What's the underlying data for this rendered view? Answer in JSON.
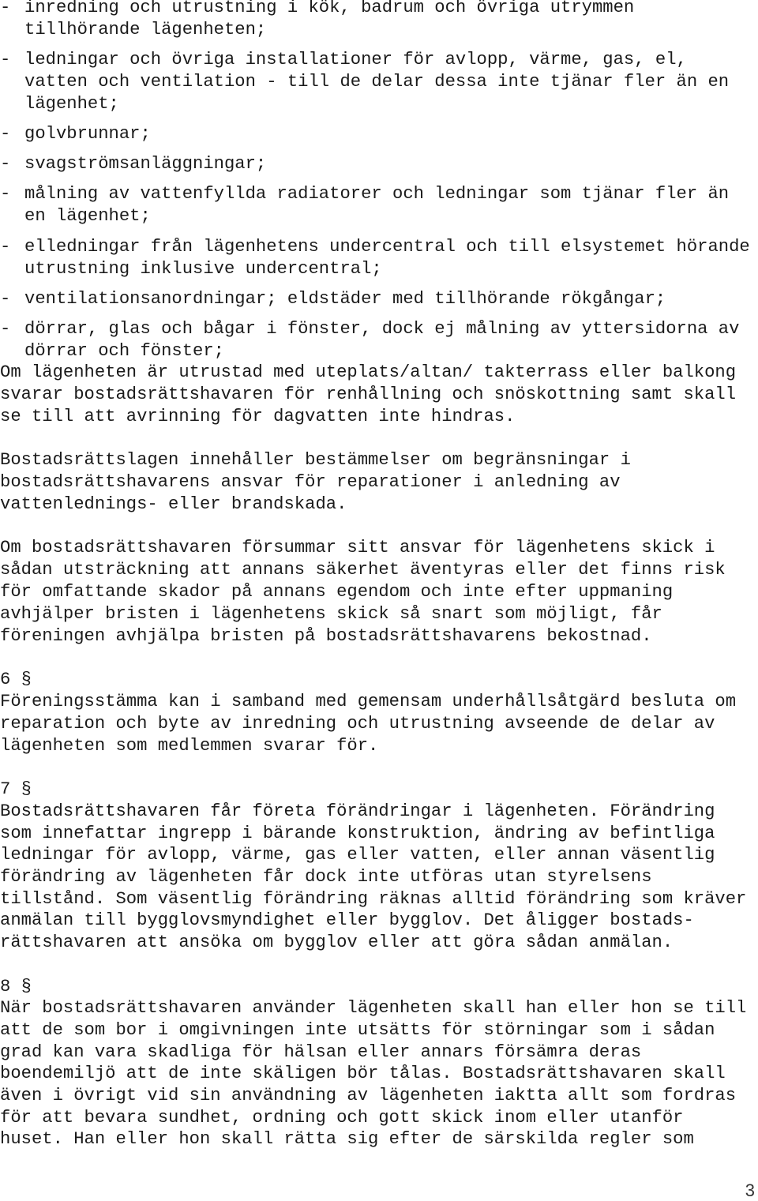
{
  "document": {
    "bullet_marker": "-",
    "bullets": [
      {
        "lines": [
          "inredning och utrustning i kök, badrum och övriga utrymmen",
          "tillhörande lägenheten;"
        ]
      },
      {
        "lines": [
          "ledningar och övriga installationer för avlopp, värme, gas, el,",
          "vatten och ventilation - till de delar dessa inte tjänar fler än en",
          "lägenhet;"
        ]
      },
      {
        "lines": [
          "golvbrunnar;"
        ]
      },
      {
        "lines": [
          "svagströmsanläggningar;"
        ]
      },
      {
        "lines": [
          "målning av vattenfyllda radiatorer och ledningar som tjänar fler än",
          "en lägenhet;"
        ]
      },
      {
        "lines": [
          "elledningar från lägenhetens undercentral och till elsystemet hörande",
          "utrustning inklusive undercentral;"
        ]
      },
      {
        "lines": [
          "ventilationsanordningar; eldstäder med tillhörande rökgångar;"
        ]
      },
      {
        "lines": [
          "dörrar, glas och bågar i fönster, dock ej målning av yttersidorna av",
          "dörrar och fönster;"
        ]
      }
    ],
    "paragraphs": [
      {
        "lines": [
          "Om lägenheten är utrustad med uteplats/altan/ takterrass eller balkong",
          "svarar bostadsrättshavaren för renhållning och snöskottning samt skall",
          "se till att avrinning för dagvatten inte hindras."
        ]
      },
      {
        "lines": [
          "Bostadsrättslagen innehåller bestämmelser om begränsningar i",
          "bostadsrättshavarens ansvar för reparationer i anledning av",
          "vattenlednings- eller brandskada."
        ]
      },
      {
        "lines": [
          "Om bostadsrättshavaren försummar sitt ansvar för lägenhetens skick i",
          "sådan utsträckning att annans säkerhet äventyras eller det finns risk",
          "för omfattande skador på annans egendom och inte efter uppmaning",
          "avhjälper bristen i lägenhetens skick så snart som möjligt, får",
          "föreningen avhjälpa bristen på bostadsrättshavarens bekostnad."
        ]
      }
    ],
    "sections": [
      {
        "heading": "6 §",
        "lines": [
          "Föreningsstämma kan i samband med gemensam underhållsåtgärd besluta om",
          "reparation och byte av inredning och utrustning avseende de delar av",
          "lägenheten som medlemmen svarar för."
        ]
      },
      {
        "heading": "7 §",
        "lines": [
          "Bostadsrättshavaren får företa förändringar i lägenheten. Förändring",
          "som innefattar ingrepp i bärande konstruktion, ändring av befintliga",
          "ledningar för avlopp, värme, gas eller vatten, eller annan väsentlig",
          "förändring av lägenheten får dock inte utföras utan styrelsens",
          "tillstånd. Som väsentlig förändring räknas alltid förändring som kräver",
          "anmälan till bygglovsmyndighet eller bygglov. Det åligger bostads-",
          "rättshavaren att ansöka om bygglov eller att göra sådan anmälan."
        ]
      },
      {
        "heading": "8 §",
        "lines": [
          "När bostadsrättshavaren använder lägenheten skall han eller hon se till",
          "att de som bor i omgivningen inte utsätts för störningar som i sådan",
          "grad kan vara skadliga för hälsan eller annars försämra deras",
          "boendemiljö att de inte skäligen bör tålas. Bostadsrättshavaren skall",
          "även i övrigt vid sin användning av lägenheten iaktta allt som fordras",
          "för att bevara sundhet, ordning och gott skick inom eller utanför",
          "huset. Han eller hon skall rätta sig efter de särskilda regler som"
        ]
      }
    ],
    "page_number": "3"
  }
}
